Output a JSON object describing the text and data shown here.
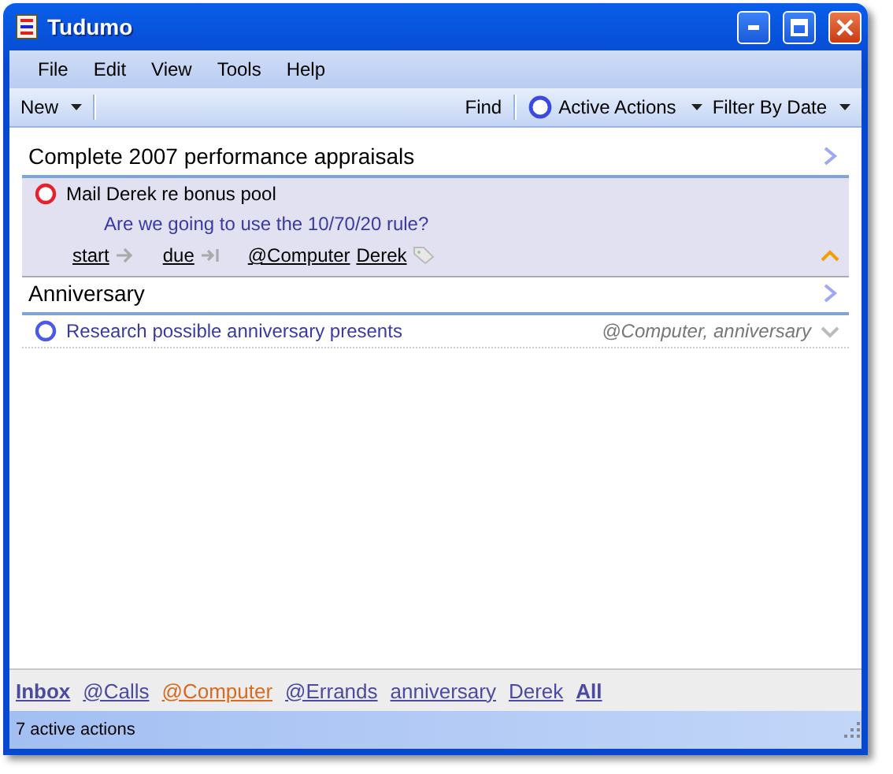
{
  "window": {
    "title": "Tudumo"
  },
  "menu": [
    "File",
    "Edit",
    "View",
    "Tools",
    "Help"
  ],
  "toolbar": {
    "new_button": "New",
    "find_button": "Find",
    "view_dropdown": "Active Actions",
    "filter_dropdown": "Filter By Date"
  },
  "projects": [
    {
      "title": "Complete 2007 performance appraisals",
      "actions": [
        {
          "title": "Mail Derek re bonus pool",
          "color": "#e8202a",
          "expanded": true,
          "note": "Are we going to use the 10/70/20 rule?",
          "start_link": "start",
          "due_link": "due",
          "tags": [
            "@Computer",
            "Derek"
          ]
        }
      ]
    },
    {
      "title": "Anniversary",
      "actions": [
        {
          "title": "Research possible anniversary presents",
          "color": "#4a5ae8",
          "expanded": false,
          "tag_summary": "@Computer, anniversary"
        }
      ]
    }
  ],
  "tag_filters": [
    {
      "label": "Inbox",
      "kind": "special",
      "selected": false
    },
    {
      "label": "@Calls",
      "kind": "tag",
      "selected": false
    },
    {
      "label": "@Computer",
      "kind": "tag",
      "selected": true
    },
    {
      "label": "@Errands",
      "kind": "tag",
      "selected": false
    },
    {
      "label": "anniversary",
      "kind": "tag",
      "selected": false
    },
    {
      "label": "Derek",
      "kind": "tag",
      "selected": false
    },
    {
      "label": "All",
      "kind": "special",
      "selected": false
    }
  ],
  "status_bar": "7 active actions"
}
